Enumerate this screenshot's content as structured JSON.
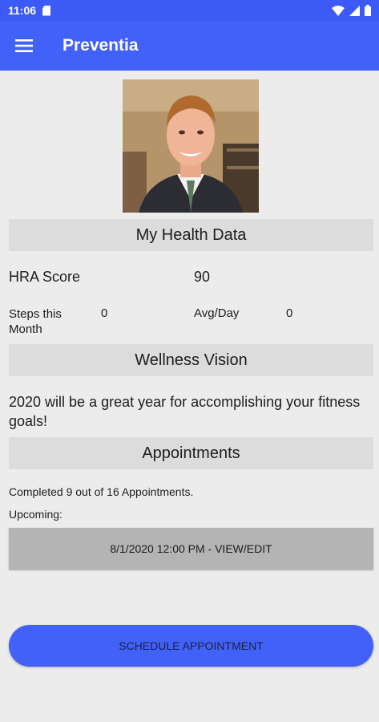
{
  "status_bar": {
    "time": "11:06",
    "icons": [
      "sd-card-icon",
      "wifi-icon",
      "signal-icon",
      "battery-icon"
    ]
  },
  "app_bar": {
    "title": "Preventia",
    "menu_icon": "hamburger-menu-icon"
  },
  "profile": {
    "photo_icon": "profile-photo"
  },
  "health_data": {
    "header": "My Health Data",
    "hra_label": "HRA Score",
    "hra_value": "90",
    "steps_label": "Steps this Month",
    "steps_value": "0",
    "avg_label": "Avg/Day",
    "avg_value": "0"
  },
  "wellness": {
    "header": "Wellness Vision",
    "text": "2020 will be a great year for accomplishing your fitness goals!"
  },
  "appointments": {
    "header": "Appointments",
    "completed_text": "Completed 9 out of 16 Appointments.",
    "upcoming_label": "Upcoming:",
    "upcoming_button": "8/1/2020 12:00 PM - VIEW/EDIT",
    "schedule_button": "SCHEDULE APPOINTMENT"
  },
  "colors": {
    "primary": "#4261f8",
    "status_bar": "#3c5af6",
    "background": "#ececec",
    "section_header": "#dcdcdc",
    "grey_button": "#b4b4b4"
  }
}
